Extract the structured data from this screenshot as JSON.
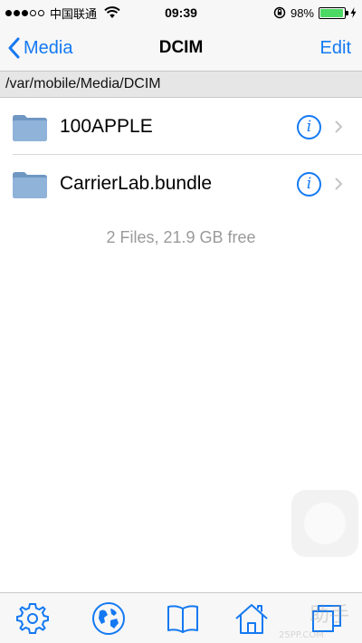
{
  "status_bar": {
    "carrier": "中国联通",
    "time": "09:39",
    "battery": "98%",
    "battery_level": 0.98,
    "signal_filled": 3,
    "signal_total": 5
  },
  "nav": {
    "back_label": "Media",
    "title": "DCIM",
    "edit_label": "Edit"
  },
  "path": "/var/mobile/Media/DCIM",
  "files": [
    {
      "name": "100APPLE"
    },
    {
      "name": "CarrierLab.bundle"
    }
  ],
  "summary": "2 Files, 21.9 GB free",
  "tabs": [
    {
      "icon": "gear-icon"
    },
    {
      "icon": "globe-icon"
    },
    {
      "icon": "book-icon"
    },
    {
      "icon": "home-icon"
    },
    {
      "icon": "windows-icon"
    }
  ],
  "colors": {
    "accent": "#1479f2",
    "folder": "#7fa6cf",
    "battery": "#4cd964"
  }
}
